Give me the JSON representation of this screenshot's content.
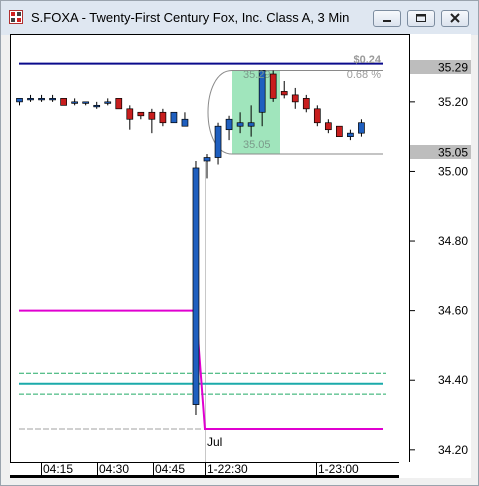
{
  "window": {
    "title": "S.FOXA - Twenty-First Century Fox, Inc. Class A, 3 Min",
    "buttons": [
      "minimize",
      "restore",
      "close"
    ]
  },
  "overlay": {
    "range_label": "$0.24",
    "pct_label": "0.68 %",
    "high_label": "35.29",
    "low_label": "35.05"
  },
  "axis_tags": {
    "upper": "35.29",
    "lower": "35.05"
  },
  "date_label": "Jul",
  "colors": {
    "up": "#1f5fbf",
    "down": "#c81e1e",
    "prev_close": "#0a0a8c",
    "magenta_line": "#e000d0",
    "teal_line": "#1aaaaa",
    "green_dashed": "#22aa66",
    "selection": "#8fe0b0"
  },
  "chart_data": {
    "type": "candlestick",
    "y_ticks": [
      "35.20",
      "35.00",
      "34.80",
      "34.60",
      "34.40",
      "34.20"
    ],
    "y_tick_values": [
      35.2,
      35.0,
      34.8,
      34.6,
      34.4,
      34.2
    ],
    "ylim": [
      34.165,
      35.395
    ],
    "x_ticks": [
      "04:15",
      "04:30",
      "04:45",
      "1-22:30",
      "1-23:00"
    ],
    "candles": [
      {
        "o": 35.2,
        "h": 35.21,
        "l": 35.19,
        "c": 35.21
      },
      {
        "o": 35.21,
        "h": 35.22,
        "l": 35.2,
        "c": 35.21
      },
      {
        "o": 35.21,
        "h": 35.22,
        "l": 35.2,
        "c": 35.21
      },
      {
        "o": 35.21,
        "h": 35.22,
        "l": 35.2,
        "c": 35.21
      },
      {
        "o": 35.21,
        "h": 35.21,
        "l": 35.19,
        "c": 35.19
      },
      {
        "o": 35.2,
        "h": 35.21,
        "l": 35.19,
        "c": 35.2
      },
      {
        "o": 35.2,
        "h": 35.2,
        "l": 35.19,
        "c": 35.2
      },
      {
        "o": 35.19,
        "h": 35.2,
        "l": 35.18,
        "c": 35.19
      },
      {
        "o": 35.2,
        "h": 35.21,
        "l": 35.19,
        "c": 35.2
      },
      {
        "o": 35.21,
        "h": 35.21,
        "l": 35.18,
        "c": 35.18
      },
      {
        "o": 35.18,
        "h": 35.19,
        "l": 35.12,
        "c": 35.15
      },
      {
        "o": 35.17,
        "h": 35.17,
        "l": 35.15,
        "c": 35.16
      },
      {
        "o": 35.17,
        "h": 35.18,
        "l": 35.11,
        "c": 35.15
      },
      {
        "o": 35.17,
        "h": 35.18,
        "l": 35.13,
        "c": 35.14
      },
      {
        "o": 35.14,
        "h": 35.17,
        "l": 35.14,
        "c": 35.17
      },
      {
        "o": 35.13,
        "h": 35.17,
        "l": 35.13,
        "c": 35.15
      },
      {
        "o": 34.33,
        "h": 35.03,
        "l": 34.3,
        "c": 35.01
      },
      {
        "o": 35.03,
        "h": 35.05,
        "l": 34.98,
        "c": 35.04
      },
      {
        "o": 35.04,
        "h": 35.14,
        "l": 35.02,
        "c": 35.13
      },
      {
        "o": 35.12,
        "h": 35.16,
        "l": 35.09,
        "c": 35.15
      },
      {
        "o": 35.13,
        "h": 35.17,
        "l": 35.11,
        "c": 35.14
      },
      {
        "o": 35.13,
        "h": 35.19,
        "l": 35.1,
        "c": 35.14
      },
      {
        "o": 35.17,
        "h": 35.29,
        "l": 35.13,
        "c": 35.29
      },
      {
        "o": 35.28,
        "h": 35.29,
        "l": 35.2,
        "c": 35.21
      },
      {
        "o": 35.23,
        "h": 35.26,
        "l": 35.21,
        "c": 35.22
      },
      {
        "o": 35.22,
        "h": 35.24,
        "l": 35.18,
        "c": 35.2
      },
      {
        "o": 35.21,
        "h": 35.22,
        "l": 35.17,
        "c": 35.18
      },
      {
        "o": 35.18,
        "h": 35.19,
        "l": 35.13,
        "c": 35.14
      },
      {
        "o": 35.14,
        "h": 35.15,
        "l": 35.11,
        "c": 35.12
      },
      {
        "o": 35.13,
        "h": 35.13,
        "l": 35.1,
        "c": 35.1
      },
      {
        "o": 35.1,
        "h": 35.12,
        "l": 35.09,
        "c": 35.11
      },
      {
        "o": 35.11,
        "h": 35.15,
        "l": 35.1,
        "c": 35.14
      }
    ],
    "prev_close": 35.31,
    "magenta_level": [
      34.6,
      34.26
    ],
    "teal_level": 34.39,
    "green_levels": [
      34.42,
      34.36
    ],
    "gray_level": 34.26
  }
}
